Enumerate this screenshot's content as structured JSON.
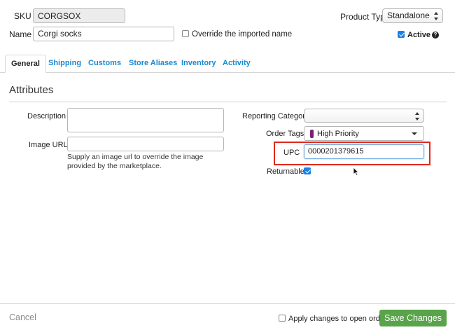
{
  "header": {
    "sku_label": "SKU",
    "sku_value": "CORGSOX",
    "name_label": "Name",
    "name_value": "Corgi socks",
    "override_label": "Override the imported name",
    "product_type_label": "Product Type",
    "product_type_value": "Standalone",
    "active_label": "Active",
    "help_icon": "?"
  },
  "tabs": [
    {
      "label": "General"
    },
    {
      "label": "Shipping"
    },
    {
      "label": "Customs"
    },
    {
      "label": "Store Aliases"
    },
    {
      "label": "Inventory"
    },
    {
      "label": "Activity"
    }
  ],
  "section_title": "Attributes",
  "attributes": {
    "description_label": "Description",
    "description_value": "",
    "image_url_label": "Image URL",
    "image_url_value": "",
    "image_url_help": "Supply an image url to override the image provided by the marketplace.",
    "reporting_category_label": "Reporting Category",
    "reporting_category_value": "",
    "order_tags_label": "Order Tags",
    "order_tags_value": "High Priority",
    "order_tag_color": "#7a1f7a",
    "upc_label": "UPC",
    "upc_value": "0000201379615",
    "returnable_label": "Returnable"
  },
  "footer": {
    "cancel_label": "Cancel",
    "apply_label": "Apply changes to open orders",
    "save_label": "Save Changes"
  },
  "colors": {
    "link": "#1a8bd0",
    "save_button": "#59a34a",
    "highlight": "#e0291b"
  },
  "icons": {
    "cursor": "mouse-pointer-icon",
    "help": "help-circle-icon",
    "dropdown": "caret-down-icon"
  }
}
